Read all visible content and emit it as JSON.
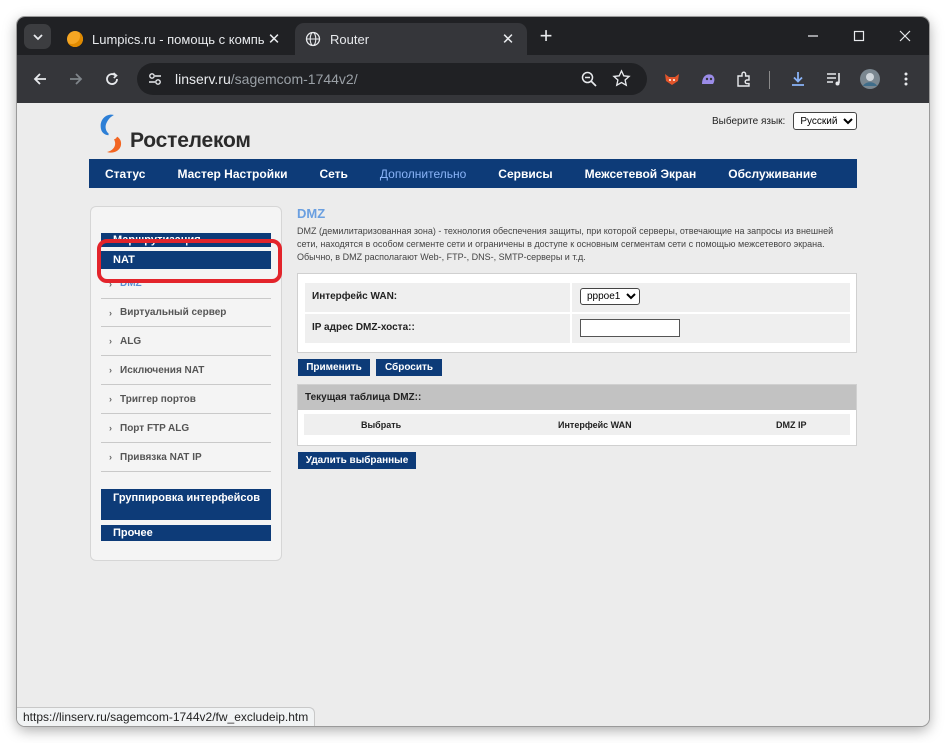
{
  "browser": {
    "tabs": [
      {
        "title": "Lumpics.ru - помощь с компь",
        "active": false
      },
      {
        "title": "Router",
        "active": true
      }
    ],
    "url_host": "linserv.ru",
    "url_path": "/sagemcom-1744v2/",
    "status_url": "https://linserv.ru/sagemcom-1744v2/fw_excludeip.htm"
  },
  "header": {
    "brand": "Ростелеком",
    "language_label": "Выберите язык:",
    "language_value": "Русский"
  },
  "nav": {
    "items": [
      "Статус",
      "Мастер Настройки",
      "Сеть",
      "Дополнительно",
      "Сервисы",
      "Межсетевой Экран",
      "Обслуживание"
    ],
    "active": "Дополнительно"
  },
  "sidebar": {
    "routing": "Маршрутизация",
    "nat": "NAT",
    "items": [
      "DMZ",
      "Виртуальный сервер",
      "ALG",
      "Исключения NAT",
      "Триггер портов",
      "Порт FTP ALG",
      "Привязка NAT IP"
    ],
    "grouping": "Группировка интерфейсов",
    "other": "Прочее"
  },
  "content": {
    "title": "DMZ",
    "description": "DMZ (демилитаризованная зона) - технология обеспечения защиты, при которой серверы, отвечающие на запросы из внешней сети, находятся в особом сегменте сети и ограничены в доступе к основным сегментам сети с помощью межсетевого экрана. Обычно, в DMZ располагают Web-, FTP-, DNS-, SMTP-серверы и т.д.",
    "wan_label": "Интерфейс WAN:",
    "wan_value": "pppoe1",
    "ip_label": "IP адрес DMZ-хоста::",
    "ip_value": "",
    "apply_button": "Применить",
    "reset_button": "Сбросить",
    "table_title": "Текущая таблица DMZ::",
    "columns": [
      "Выбрать",
      "Интерфейс WAN",
      "DMZ IP"
    ],
    "delete_button": "Удалить выбранные"
  },
  "colors": {
    "nav_blue": "#0d3b78",
    "highlight_red": "#e3242b",
    "link_blue": "#6a9fe0"
  }
}
